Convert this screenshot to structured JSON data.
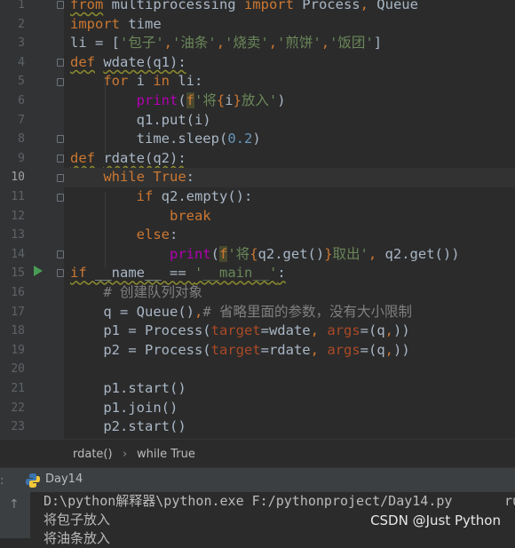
{
  "editor": {
    "line_numbers": [
      "1",
      "2",
      "3",
      "4",
      "5",
      "6",
      "7",
      "8",
      "9",
      "10",
      "11",
      "12",
      "13",
      "14",
      "15",
      "16",
      "17",
      "18",
      "19",
      "20",
      "21",
      "22",
      "23"
    ],
    "current_line": "10"
  },
  "breadcrumb": {
    "function": "rdate()",
    "separator": "›",
    "statement": "while True"
  },
  "run_tab": {
    "label": "Day14"
  },
  "console": {
    "lines": [
      "D:\\python解释器\\python.exe F:/pythonproject/Day14.py",
      "将包子放入",
      "将油条放入"
    ],
    "overflow": "ru"
  },
  "watermark": "CSDN @Just Python",
  "colors": {
    "keyword": "#cc7832",
    "string": "#6a8759",
    "builtin": "#b200b2",
    "number": "#6897bb",
    "comment": "#808080",
    "param": "#aa4926",
    "text": "#a9b7c6"
  }
}
